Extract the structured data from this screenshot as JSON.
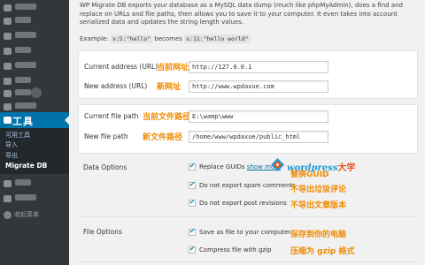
{
  "sidebar": {
    "tools_heading": "工具",
    "submenu": [
      "可用工具",
      "导入",
      "导出",
      "Migrate DB"
    ],
    "collapse_label": "收起菜单"
  },
  "intro": {
    "text": "WP Migrate DB exports your database as a MySQL data dump (much like phpMyAdmin), does a find and replace on URLs and file paths, then allows you to save it to your computer. It even takes into account serialized data and updates the string length values.",
    "example_prefix": "Example:",
    "example_from": "s:5:\"hello\"",
    "example_mid": "becomes",
    "example_to": "s:11:\"hello world\""
  },
  "address": {
    "current_label": "Current address (URL)",
    "current_value": "http://127.0.0.1",
    "current_note": "当前网址",
    "new_label": "New address (URL)",
    "new_value": "http://www.wpdaxue.com",
    "new_note": "新网址"
  },
  "filepath": {
    "current_label": "Current file path",
    "current_value": "E:\\wamp\\www",
    "current_note": "当前文件路径",
    "new_label": "New file path",
    "new_value": "/home/www/wpdaxue/public_html",
    "new_note": "新文件路径"
  },
  "data_options": {
    "heading": "Data Options",
    "items": [
      {
        "label": "Replace GUIDs",
        "link": "show more",
        "note": "替换GUID",
        "checked": true
      },
      {
        "label": "Do not export spam comments",
        "note": "不导出垃圾评论",
        "checked": true
      },
      {
        "label": "Do not export post revisions",
        "note": "不导出文章版本",
        "checked": true
      }
    ]
  },
  "file_options": {
    "heading": "File Options",
    "items": [
      {
        "label": "Save as file to your computer",
        "note": "保存到你的电脑",
        "checked": true
      },
      {
        "label": "Compress file with gzip",
        "note": "压缩为 gzip 格式",
        "checked": true
      }
    ]
  },
  "watermark": {
    "text": "wordpress",
    "text_cn": "大学"
  },
  "colors": {
    "sidebar_bg": "#32373c",
    "submenu_bg": "#23282d",
    "active_menu": "#0073aa",
    "note_orange": "#f08a00",
    "link_blue": "#0073aa"
  }
}
